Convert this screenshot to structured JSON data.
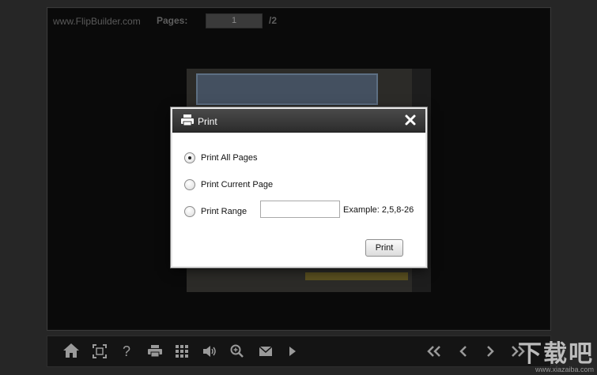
{
  "viewer": {
    "brand": "www.FlipBuilder.com",
    "pages_label": "Pages:",
    "current_page": "1",
    "page_total": "/2"
  },
  "dialog": {
    "title": "Print",
    "options": [
      {
        "label": "Print All Pages",
        "checked": true
      },
      {
        "label": "Print Current Page",
        "checked": false
      },
      {
        "label": "Print Range",
        "checked": false
      }
    ],
    "range_value": "",
    "range_example": "Example: 2,5,8-26",
    "print_button": "Print"
  },
  "toolbar": {
    "left_icons": [
      "home-icon",
      "fullscreen-icon",
      "help-icon",
      "print-icon",
      "thumbnails-icon",
      "sound-icon",
      "zoom-in-icon",
      "email-icon",
      "autoplay-icon"
    ],
    "right_icons": [
      "first-page-icon",
      "previous-page-icon",
      "next-page-icon",
      "last-page-icon"
    ]
  },
  "watermark": {
    "text": "下载吧",
    "url": "www.xiazaiba.com"
  },
  "colors": {
    "background": "#262626",
    "viewer_bg": "#0a0a0a",
    "dialog_header": "#2c2c2c",
    "icon": "#9a9a9a"
  }
}
